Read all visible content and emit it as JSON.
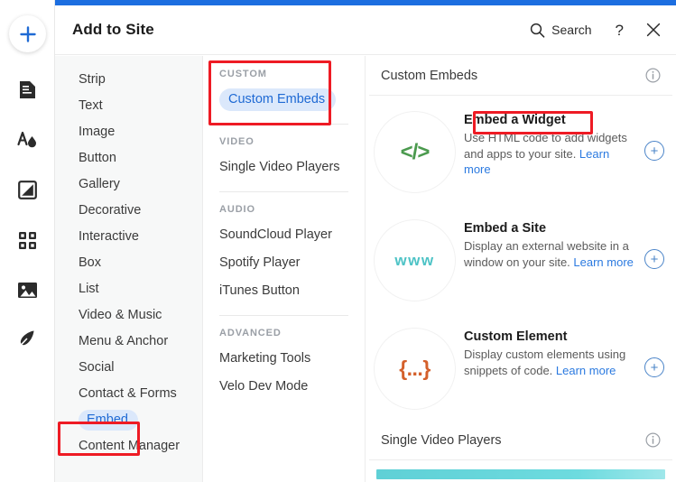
{
  "header": {
    "title": "Add to Site",
    "search_label": "Search",
    "help_label": "?",
    "close_label": "✕"
  },
  "rail": {
    "items": [
      {
        "name": "add-plus-button",
        "label": "Add"
      },
      {
        "name": "pages-icon",
        "label": "Pages"
      },
      {
        "name": "theme-icon",
        "label": "Site Design"
      },
      {
        "name": "background-icon",
        "label": "Background"
      },
      {
        "name": "apps-icon",
        "label": "Apps"
      },
      {
        "name": "media-icon",
        "label": "Media"
      },
      {
        "name": "blog-icon",
        "label": "Blog"
      }
    ]
  },
  "categories": {
    "items": [
      {
        "label": "Strip",
        "active": false
      },
      {
        "label": "Text",
        "active": false
      },
      {
        "label": "Image",
        "active": false
      },
      {
        "label": "Button",
        "active": false
      },
      {
        "label": "Gallery",
        "active": false
      },
      {
        "label": "Decorative",
        "active": false
      },
      {
        "label": "Interactive",
        "active": false
      },
      {
        "label": "Box",
        "active": false
      },
      {
        "label": "List",
        "active": false
      },
      {
        "label": "Video & Music",
        "active": false
      },
      {
        "label": "Menu & Anchor",
        "active": false
      },
      {
        "label": "Social",
        "active": false
      },
      {
        "label": "Contact & Forms",
        "active": false
      },
      {
        "label": "Embed",
        "active": true
      },
      {
        "label": "Content Manager",
        "active": false
      }
    ]
  },
  "subcategories": {
    "groups": [
      {
        "title": "CUSTOM",
        "items": [
          {
            "label": "Custom Embeds",
            "active": true
          }
        ]
      },
      {
        "title": "VIDEO",
        "items": [
          {
            "label": "Single Video Players",
            "active": false
          }
        ]
      },
      {
        "title": "AUDIO",
        "items": [
          {
            "label": "SoundCloud Player",
            "active": false
          },
          {
            "label": "Spotify Player",
            "active": false
          },
          {
            "label": "iTunes Button",
            "active": false
          }
        ]
      },
      {
        "title": "ADVANCED",
        "items": [
          {
            "label": "Marketing Tools",
            "active": false
          },
          {
            "label": "Velo Dev Mode",
            "active": false
          }
        ]
      }
    ]
  },
  "main": {
    "section_title": "Custom Embeds",
    "cards": [
      {
        "icon": "code-icon",
        "icon_glyph": "</>",
        "title": "Embed a Widget",
        "desc": "Use HTML code to add widgets and apps to your site. ",
        "link": "Learn more",
        "add_label": "+"
      },
      {
        "icon": "www-icon",
        "icon_glyph": "www",
        "title": "Embed a Site",
        "desc": "Display an external website in a window on your site. ",
        "link": "Learn more",
        "add_label": "+"
      },
      {
        "icon": "curly-braces-icon",
        "icon_glyph": "{...}",
        "title": "Custom Element",
        "desc": "Display custom elements using snippets of code. ",
        "link": "Learn more",
        "add_label": "+"
      }
    ],
    "next_section_title": "Single Video Players"
  },
  "annotations": {
    "accent_blue": "#1c6ee0",
    "highlight_red": "#ee1b24",
    "pill_blue_bg": "#dbe8fb",
    "link_blue": "#2b7ae0"
  }
}
